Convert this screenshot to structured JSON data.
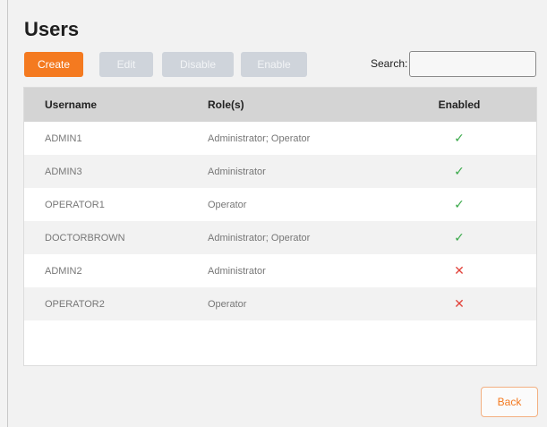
{
  "page": {
    "title": "Users"
  },
  "toolbar": {
    "create_label": "Create",
    "edit_label": "Edit",
    "disable_label": "Disable",
    "enable_label": "Enable",
    "search_label": "Search:",
    "search_value": ""
  },
  "table": {
    "columns": [
      "Username",
      "Role(s)",
      "Enabled"
    ],
    "rows": [
      {
        "username": "ADMIN1",
        "roles": "Administrator; Operator",
        "enabled": "✓"
      },
      {
        "username": "ADMIN3",
        "roles": "Administrator",
        "enabled": "✓"
      },
      {
        "username": "OPERATOR1",
        "roles": "Operator",
        "enabled": "✓"
      },
      {
        "username": "DOCTORBROWN",
        "roles": "Administrator; Operator",
        "enabled": "✓"
      },
      {
        "username": "ADMIN2",
        "roles": "Administrator",
        "enabled": "✕"
      },
      {
        "username": "OPERATOR2",
        "roles": "Operator",
        "enabled": "✕"
      }
    ]
  },
  "footer": {
    "back_label": "Back"
  },
  "colors": {
    "accent": "#f47a20",
    "enabled_yes": "#3aa94a",
    "enabled_no": "#e2443c",
    "disabled_button": "#cfd4db"
  }
}
